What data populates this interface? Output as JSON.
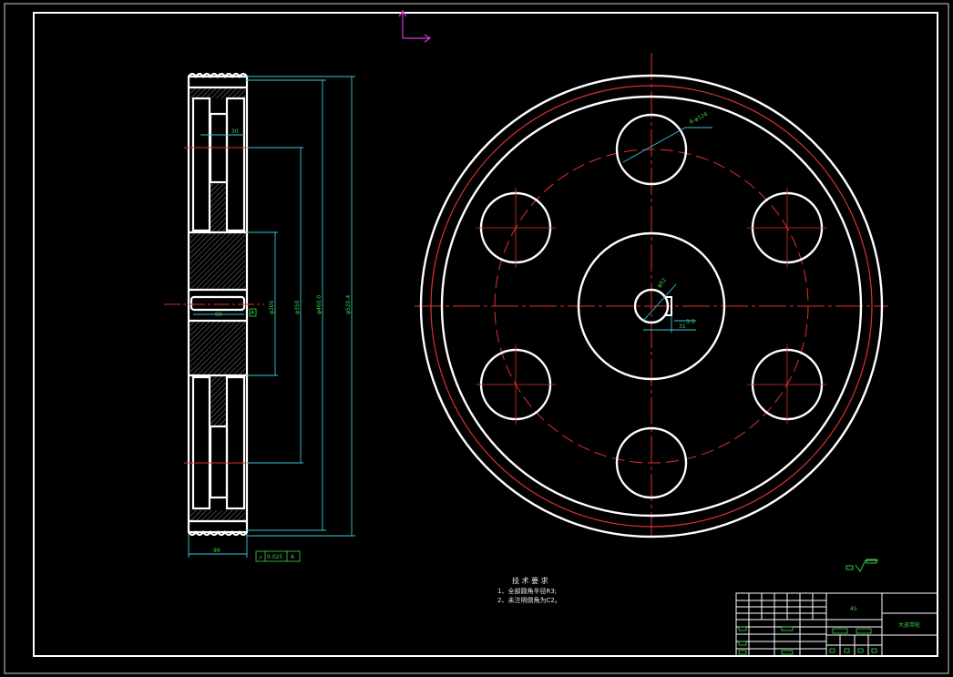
{
  "drawing": {
    "side_view_dims": {
      "width_top": "30",
      "hub_width": "90",
      "d_hub": "φ200",
      "d_web": "φ350",
      "d_root": "φ460.0",
      "d_outer": "φ520.4",
      "total_width": "99",
      "tolerance_symbol": "↗",
      "tolerance_value": "0.025",
      "datum": "A",
      "datum_mark": "A"
    },
    "front_view_dims": {
      "holes": "6-φ124",
      "bore": "φ52",
      "keyway": "3.5",
      "key_depth": "31"
    },
    "tech_requirements": {
      "heading": "技 术 要 求",
      "item1": "1、全部圆角半径R3;",
      "item2": "2、未注明倒角为C2。"
    },
    "title_block": {
      "material": "45",
      "part_name": "大皮带轮"
    }
  }
}
